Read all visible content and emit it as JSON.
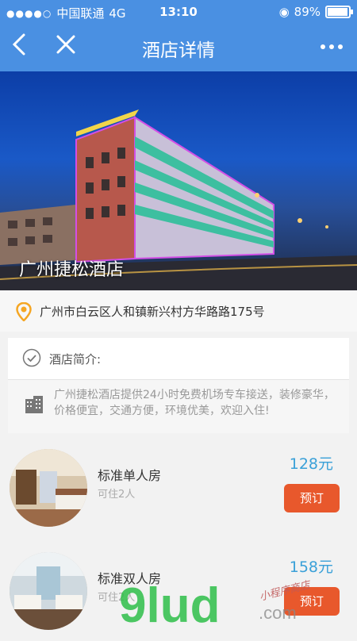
{
  "status_bar": {
    "carrier": "中国联通",
    "network": "4G",
    "time": "13:10",
    "battery": "89%",
    "battery_level": 0.89
  },
  "nav": {
    "back_icon": "chevron-left-icon",
    "close_icon": "close-icon",
    "title": "酒店详情",
    "more_icon": "more-icon"
  },
  "hotel": {
    "name": "广州捷松酒店",
    "address": "广州市白云区人和镇新兴村方华路路175号"
  },
  "intro": {
    "title": "酒店简介:",
    "description": "广州捷松酒店提供24小时免费机场专车接送，装修豪华，价格便宜，交通方便，环境优美，欢迎入住!"
  },
  "rooms": [
    {
      "name": "标准单人房",
      "capacity": "可住2人",
      "price": "128元",
      "book_label": "预订"
    },
    {
      "name": "标准双人房",
      "capacity": "可住2人",
      "price": "158元",
      "book_label": "预订"
    }
  ],
  "watermark": {
    "brand": "9lud",
    "tag": "小程序商店",
    "suffix": ".com"
  },
  "colors": {
    "primary": "#4a90e2",
    "book": "#e8582c",
    "price": "#3aa0d8",
    "pin": "#f5a623"
  }
}
